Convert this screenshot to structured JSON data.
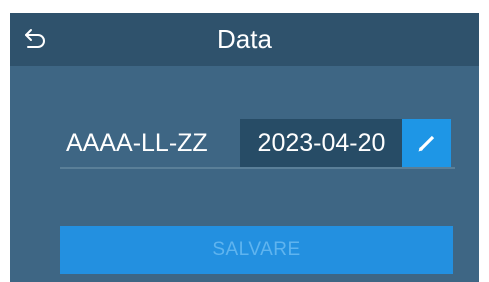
{
  "header": {
    "title": "Data",
    "back_icon": "back-arrow-icon"
  },
  "date_field": {
    "format_label": "AAAA-LL-ZZ",
    "value": "2023-04-20",
    "edit_icon": "pencil-icon"
  },
  "actions": {
    "save_label": "SALVARE",
    "save_enabled": false
  },
  "colors": {
    "background": "#3e6684",
    "header": "#2f526c",
    "value_box": "#274c66",
    "accent": "#1e96e6",
    "button_text_disabled": "#5fb4ef"
  }
}
